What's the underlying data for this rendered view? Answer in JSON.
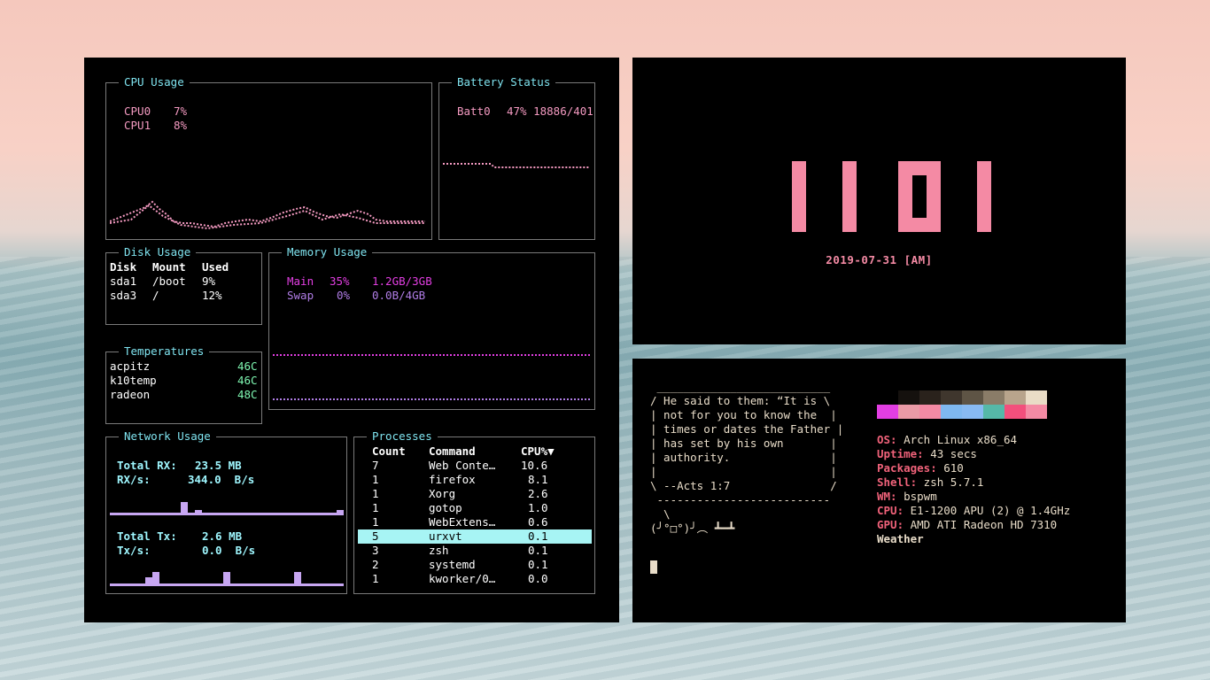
{
  "cpu": {
    "title": "CPU Usage",
    "cores": [
      {
        "name": "CPU0",
        "value": "7%"
      },
      {
        "name": "CPU1",
        "value": "8%"
      }
    ]
  },
  "battery": {
    "title": "Battery Status",
    "name": "Batt0",
    "value": "47% 18886/401"
  },
  "disk": {
    "title": "Disk Usage",
    "headers": [
      "Disk",
      "Mount",
      "Used"
    ],
    "rows": [
      [
        "sda1",
        "/boot",
        "9%"
      ],
      [
        "sda3",
        "/",
        "12%"
      ]
    ]
  },
  "memory": {
    "title": "Memory Usage",
    "main": {
      "name": "Main",
      "pct": "35%",
      "val": "1.2GB/3GB"
    },
    "swap": {
      "name": "Swap",
      "pct": "0%",
      "val": "0.0B/4GB"
    }
  },
  "temps": {
    "title": "Temperatures",
    "rows": [
      [
        "acpitz",
        "46C"
      ],
      [
        "k10temp",
        "46C"
      ],
      [
        "radeon",
        "48C"
      ]
    ]
  },
  "network": {
    "title": "Network Usage",
    "rx_total_label": "Total RX:",
    "rx_total": "23.5 MB",
    "rx_rate_label": "RX/s:",
    "rx_rate": "344.0  B/s",
    "tx_total_label": "Total Tx:",
    "tx_total": "2.6 MB",
    "tx_rate_label": "Tx/s:",
    "tx_rate": "0.0  B/s"
  },
  "processes": {
    "title": "Processes",
    "headers": [
      "Count",
      "Command",
      "CPU%▼"
    ],
    "rows": [
      [
        "7",
        "Web Conte…",
        "10.6"
      ],
      [
        "1",
        "firefox",
        "8.1"
      ],
      [
        "1",
        "Xorg",
        "2.6"
      ],
      [
        "1",
        "gotop",
        "1.0"
      ],
      [
        "1",
        "WebExtens…",
        "0.6"
      ],
      [
        "5",
        "urxvt",
        "0.1"
      ],
      [
        "3",
        "zsh",
        "0.1"
      ],
      [
        "2",
        "systemd",
        "0.1"
      ],
      [
        "1",
        "kworker/0…",
        "0.0"
      ]
    ],
    "selected_index": 5
  },
  "clock": {
    "time": "1101",
    "date": "2019-07-31 [AM]"
  },
  "fetch": {
    "quote_lines": [
      " __________________________",
      "/ He said to them: “It is \\",
      "| not for you to know the  |",
      "| times or dates the Father |",
      "| has set by his own       |",
      "| authority.               |",
      "|                          |",
      "\\ --Acts 1:7               /",
      " --------------------------",
      "  \\",
      "(╯°□°)╯︵ ┻━┻"
    ],
    "info": [
      {
        "label": "OS:",
        "value": " Arch Linux x86_64"
      },
      {
        "label": "Uptime:",
        "value": " 43 secs"
      },
      {
        "label": "Packages:",
        "value": " 610"
      },
      {
        "label": "Shell:",
        "value": " zsh 5.7.1"
      },
      {
        "label": "WM:",
        "value": " bspwm"
      },
      {
        "label": "CPU:",
        "value": " E1-1200 APU (2) @ 1.4GHz"
      },
      {
        "label": "GPU:",
        "value": " AMD ATI Radeon HD 7310"
      },
      {
        "label": "Weather",
        "value": ""
      }
    ],
    "palette_top": [
      "#000000",
      "#15110e",
      "#2a221c",
      "#3f362d",
      "#5e5445",
      "#8a7c68",
      "#b8a48c",
      "#e9dcc6"
    ],
    "palette_bottom": [
      "#e23ee2",
      "#ea9aa6",
      "#f48aa4",
      "#7fb8f0",
      "#88baf2",
      "#55b8a8",
      "#f24f7c",
      "#f48aa4"
    ]
  }
}
